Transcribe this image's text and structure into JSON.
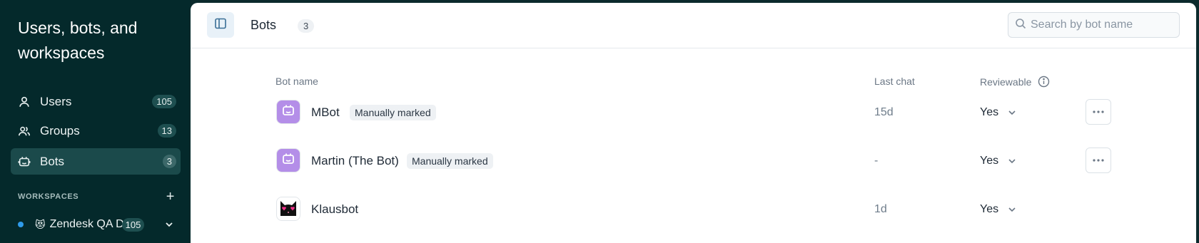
{
  "sidebar": {
    "title": "Users, bots, and workspaces",
    "nav": [
      {
        "label": "Users",
        "count": "105",
        "icon": "user-icon"
      },
      {
        "label": "Groups",
        "count": "13",
        "icon": "groups-icon"
      },
      {
        "label": "Bots",
        "count": "3",
        "icon": "bot-icon",
        "active": true
      }
    ],
    "workspaces_header": "WORKSPACES",
    "workspace": {
      "emoji": "😻",
      "name": "Zendesk QA Demo",
      "count": "105",
      "dot_color": "#2f9bea"
    }
  },
  "header": {
    "title": "Bots",
    "count": "3",
    "search_placeholder": "Search by bot name"
  },
  "table": {
    "columns": {
      "name": "Bot name",
      "last_chat": "Last chat",
      "reviewable": "Reviewable"
    },
    "rows": [
      {
        "name": "MBot",
        "tag": "Manually marked",
        "last_chat": "15d",
        "reviewable": "Yes",
        "avatar": "bot-icon"
      },
      {
        "name": "Martin (The Bot)",
        "tag": "Manually marked",
        "last_chat": "-",
        "reviewable": "Yes",
        "avatar": "bot-icon"
      },
      {
        "name": "Klausbot",
        "tag": "",
        "last_chat": "1d",
        "reviewable": "Yes",
        "avatar": "cat-heart-eyes-icon"
      }
    ]
  },
  "colors": {
    "sidebar_bg": "#04292b",
    "active_nav_bg": "#1b4a4b",
    "bot_avatar_bg": "#b48ee8"
  }
}
